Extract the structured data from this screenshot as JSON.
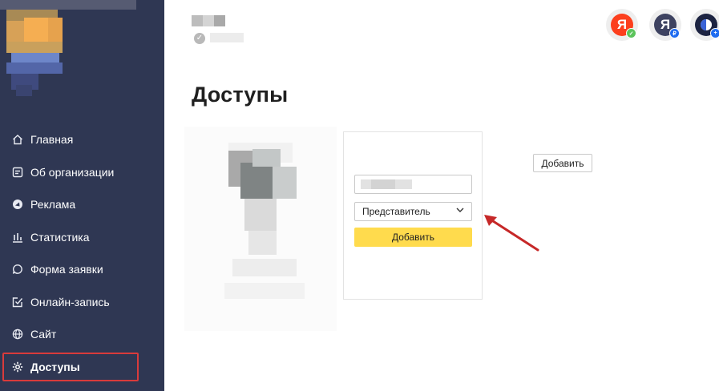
{
  "sidebar": {
    "items": [
      {
        "label": "Главная",
        "icon": "home-icon"
      },
      {
        "label": "Об организации",
        "icon": "info-card-icon"
      },
      {
        "label": "Реклама",
        "icon": "megaphone-icon"
      },
      {
        "label": "Статистика",
        "icon": "bar-chart-icon"
      },
      {
        "label": "Форма заявки",
        "icon": "chat-bubble-icon"
      },
      {
        "label": "Онлайн-запись",
        "icon": "calendar-check-icon"
      },
      {
        "label": "Сайт",
        "icon": "globe-icon"
      },
      {
        "label": "Доступы",
        "icon": "gear-icon",
        "active": true
      }
    ]
  },
  "header": {
    "avatars": [
      {
        "letter": "Я",
        "color": "#fc3f1d",
        "badge_color": "#5cc45c",
        "icon": "yandex-icon"
      },
      {
        "letter": "Я",
        "color": "#3d4260",
        "badge_color": "#1f6cf0",
        "badge_text": "₽",
        "icon": "yandex-business-icon"
      },
      {
        "letter": "",
        "color": "#1c2341",
        "badge_color": "#1f6cf0",
        "badge_text": "+",
        "icon": "profile-avatar-icon"
      }
    ]
  },
  "page": {
    "title": "Доступы"
  },
  "form": {
    "role_selected": "Представитель",
    "add_label": "Добавить"
  },
  "toolbar": {
    "add_label": "Добавить"
  },
  "colors": {
    "sidebar_bg": "#2f3753",
    "accent_yellow": "#ffdb4d",
    "highlight_red": "#d93b3b",
    "arrow_red": "#c62828"
  }
}
